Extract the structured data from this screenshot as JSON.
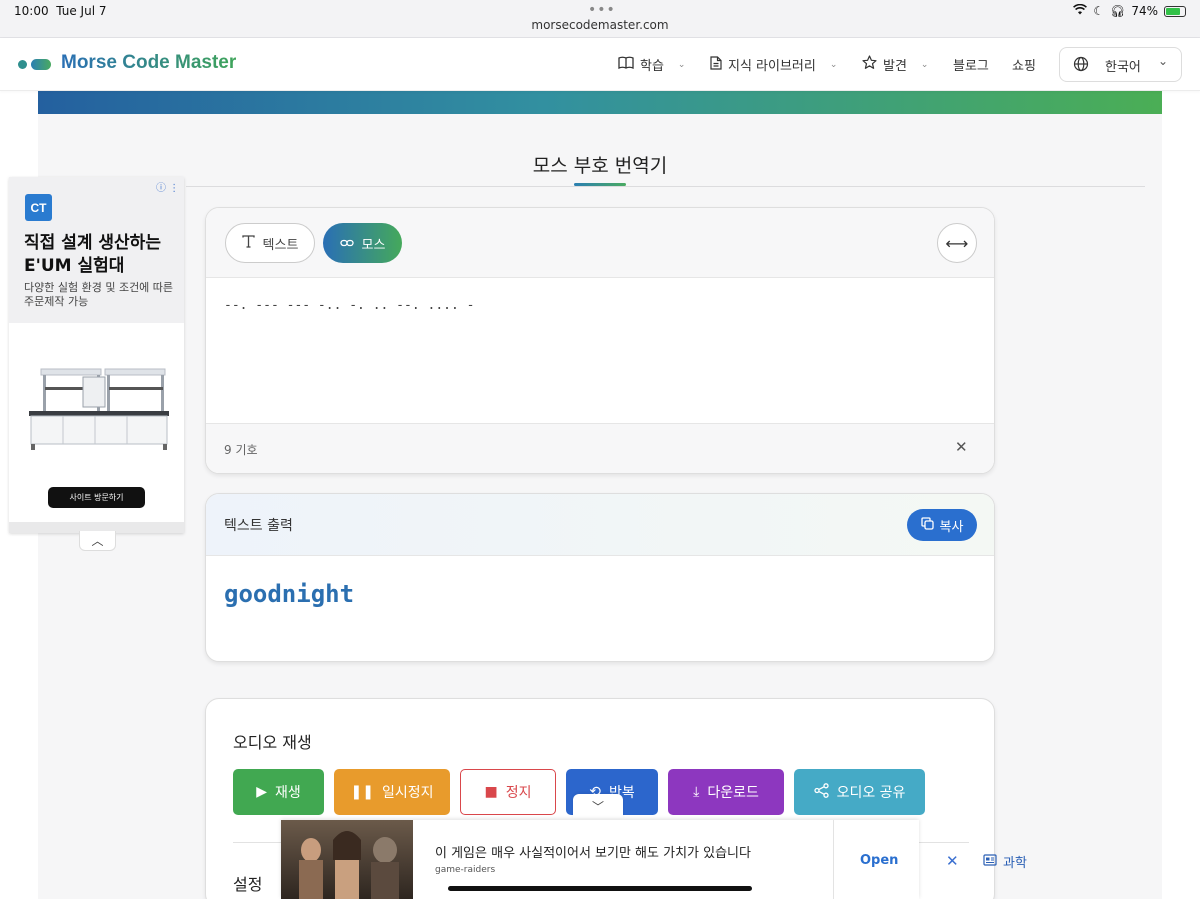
{
  "status": {
    "time": "10:00",
    "date": "Tue Jul 7",
    "url": "morsecodemaster.com",
    "battery": "74%"
  },
  "nav": {
    "logo": "Morse Code Master",
    "items": [
      {
        "label": "학습",
        "icon": "book-icon"
      },
      {
        "label": "지식 라이브러리",
        "icon": "document-icon"
      },
      {
        "label": "발견",
        "icon": "star-icon"
      },
      {
        "label": "블로그"
      },
      {
        "label": "쇼핑"
      }
    ],
    "language": "한국어"
  },
  "page": {
    "title": "모스 부호 번역기"
  },
  "translator": {
    "tab_text": "텍스트",
    "tab_morse": "모스",
    "input_value": "--. --- --- -.. -. .. --. .... -",
    "symbol_count": "9 기호",
    "output_title": "텍스트 출력",
    "copy_label": "복사",
    "output_value": "goodnight"
  },
  "audio": {
    "title": "오디오 재생",
    "play": "재생",
    "pause": "일시정지",
    "stop": "정지",
    "loop": "반복",
    "download": "다운로드",
    "share": "오디오 공유",
    "settings": "설정"
  },
  "ad_left": {
    "logo": "CT",
    "headline": "직접 설계 생산하는 E'UM 실험대",
    "subtext": "다양한 실험 환경 및 조건에 따른 주문제작 가능",
    "cta": "사이트 방문하기"
  },
  "ad_bottom": {
    "text": "이 게임은 매우 사실적이어서 보기만 해도 가치가 있습니다",
    "source": "game-raiders",
    "open": "Open",
    "badge": "과학"
  },
  "colors": {
    "brand_blue": "#2a6fb5",
    "brand_green": "#45a95b",
    "play": "#41a851",
    "pause": "#e89b2c",
    "stop": "#d9474b",
    "loop": "#2c66cc",
    "download": "#8d37bf",
    "share": "#45aac6"
  }
}
